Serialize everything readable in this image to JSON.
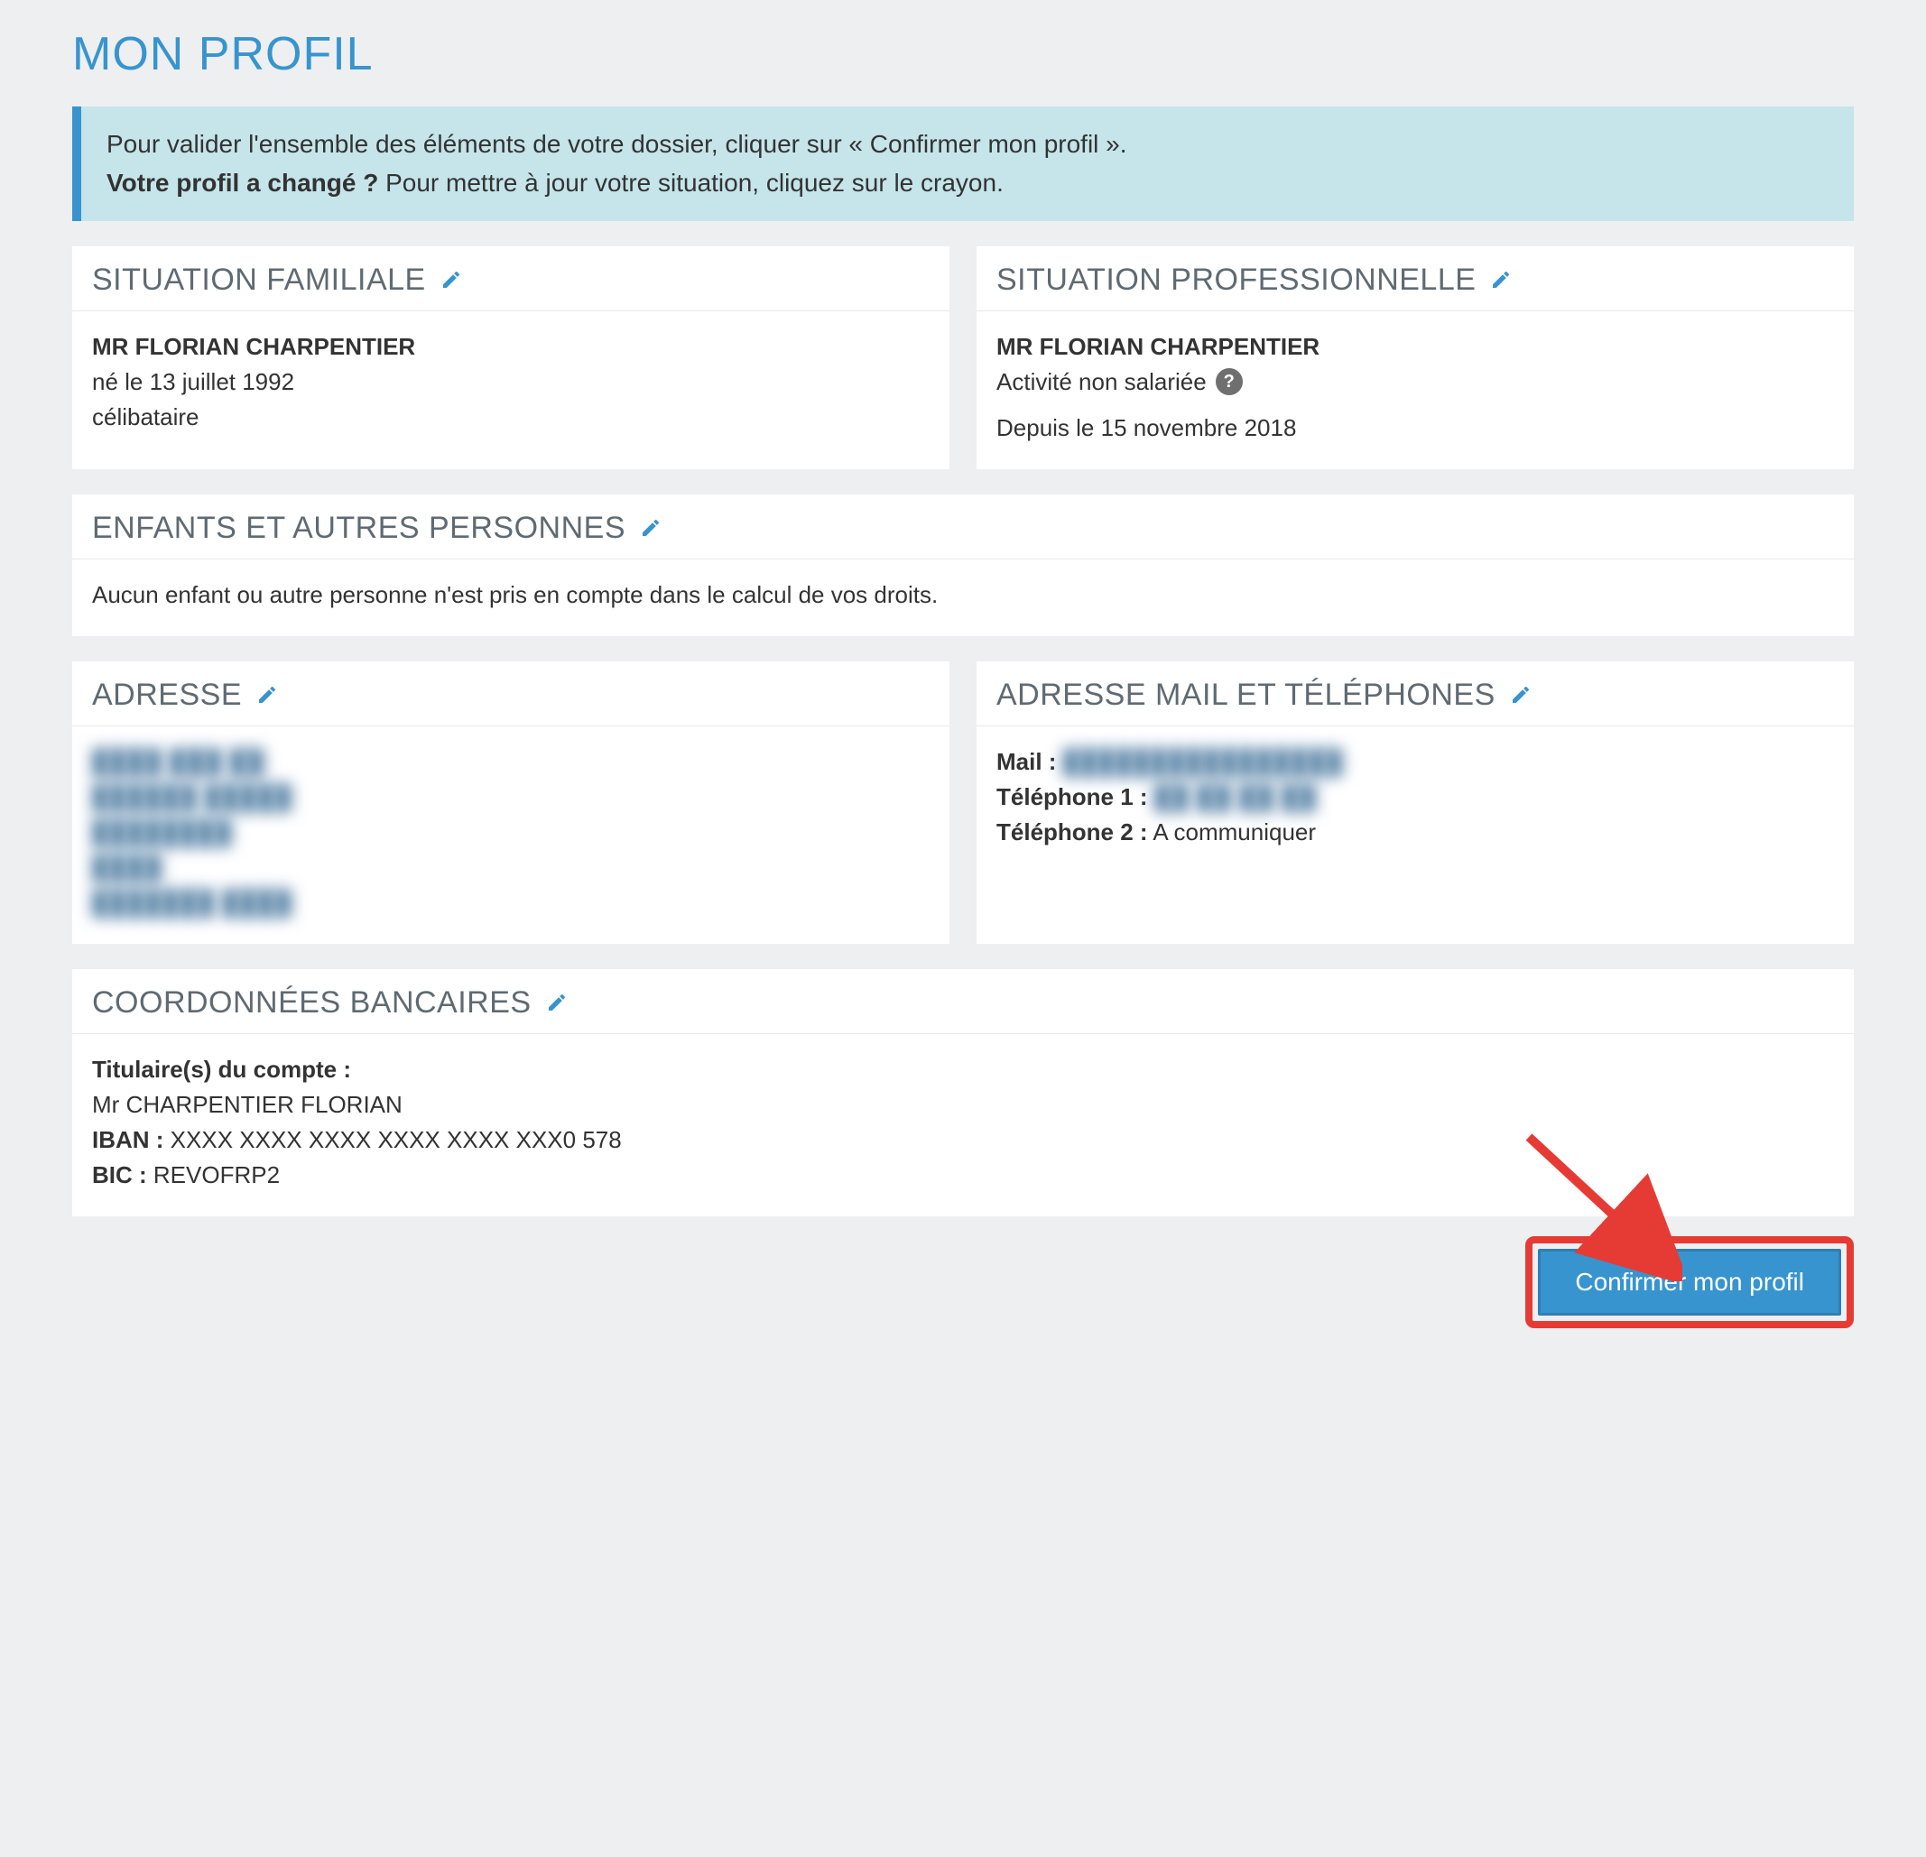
{
  "page_title": "MON PROFIL",
  "banner": {
    "line1": "Pour valider l'ensemble des éléments de votre dossier, cliquer sur « Confirmer mon profil ».",
    "bold": "Votre profil a changé ?",
    "line2_tail": " Pour mettre à jour votre situation, cliquez sur le crayon."
  },
  "family": {
    "title": "SITUATION FAMILIALE",
    "name": "MR FLORIAN CHARPENTIER",
    "birth": "né le 13 juillet 1992",
    "status": "célibataire"
  },
  "professional": {
    "title": "SITUATION PROFESSIONNELLE",
    "name": "MR FLORIAN CHARPENTIER",
    "activity": "Activité non salariée",
    "since": "Depuis le 15 novembre 2018"
  },
  "children": {
    "title": "ENFANTS ET AUTRES PERSONNES",
    "text": "Aucun enfant ou autre personne n'est pris en compte dans le calcul de vos droits."
  },
  "address": {
    "title": "ADRESSE",
    "lines": [
      "████ ███ ██",
      "██████ █████",
      "████████",
      "████",
      "███████ ████"
    ]
  },
  "contact": {
    "title": "ADRESSE MAIL ET TÉLÉPHONES",
    "mail_label": "Mail :",
    "mail_value": "████████████████",
    "tel1_label": "Téléphone 1 :",
    "tel1_value": "██ ██ ██ ██",
    "tel2_label": "Téléphone 2 :",
    "tel2_value": "A communiquer"
  },
  "bank": {
    "title": "COORDONNÉES BANCAIRES",
    "holder_label": "Titulaire(s) du compte :",
    "holder_value": "Mr CHARPENTIER FLORIAN",
    "iban_label": "IBAN :",
    "iban_value": "XXXX XXXX XXXX XXXX XXXX XXX0 578",
    "bic_label": "BIC :",
    "bic_value": "REVOFRP2"
  },
  "confirm_button": "Confirmer mon profil",
  "icons": {
    "pencil": "pencil-icon",
    "help": "?"
  }
}
